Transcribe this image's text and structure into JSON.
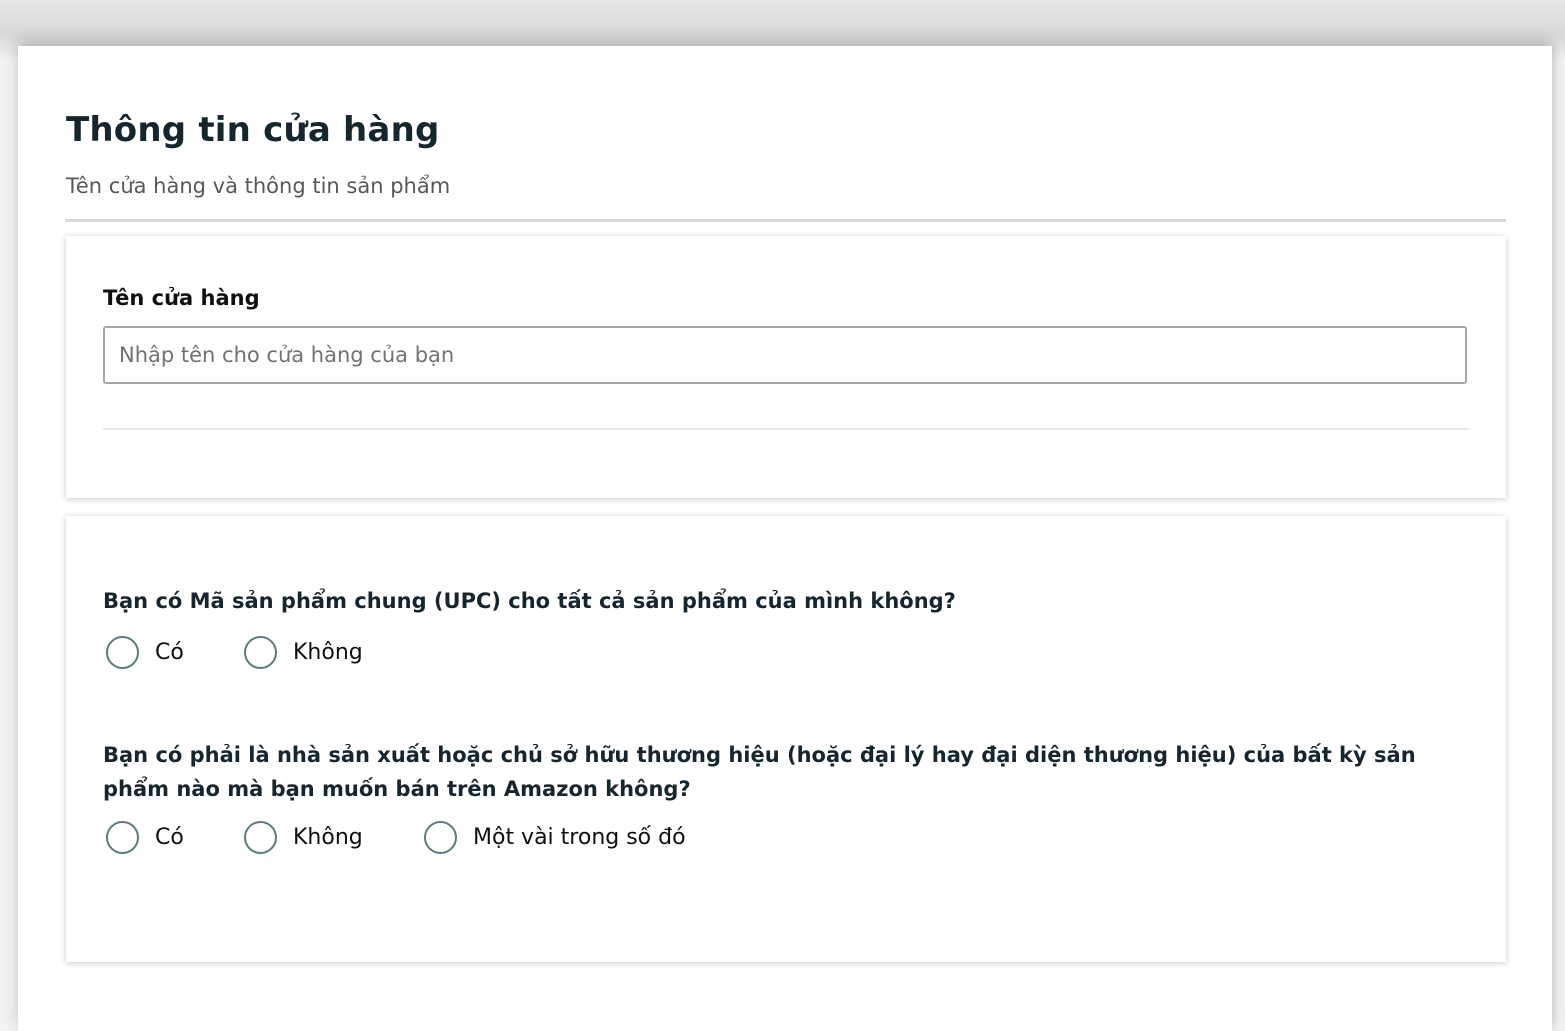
{
  "header": {
    "title": "Thông tin cửa hàng",
    "subtitle": "Tên cửa hàng và thông tin sản phẩm"
  },
  "store_name": {
    "label": "Tên cửa hàng",
    "value": "",
    "placeholder": "Nhập tên cho cửa hàng của bạn"
  },
  "questions": [
    {
      "text": "Bạn có Mã sản phẩm chung (UPC) cho tất cả sản phẩm của mình không?",
      "options": [
        "Có",
        "Không"
      ],
      "selected": null
    },
    {
      "text": "Bạn có phải là nhà sản xuất hoặc chủ sở hữu thương hiệu (hoặc đại lý hay đại diện thương hiệu) của bất kỳ sản phẩm nào mà bạn muốn bán trên Amazon không?",
      "options": [
        "Có",
        "Không",
        "Một vài trong số đó"
      ],
      "selected": null
    }
  ],
  "colors": {
    "title": "#16262f",
    "subtitle": "#565959",
    "radio_border": "#5d7a7e",
    "input_border": "#a6a6a6"
  }
}
